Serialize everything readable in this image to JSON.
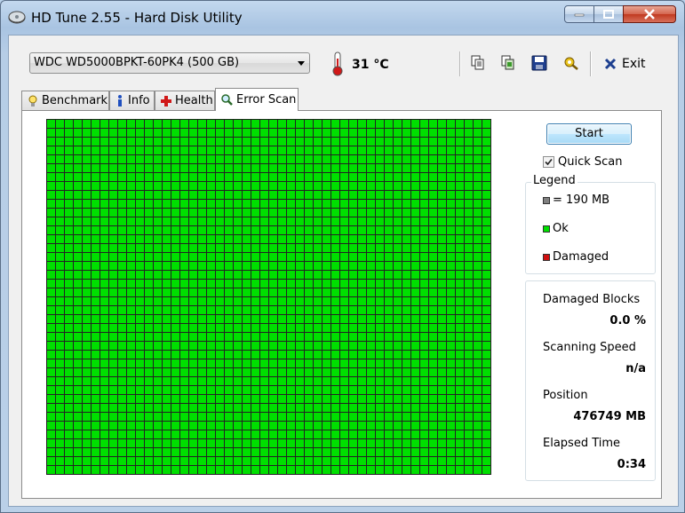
{
  "window": {
    "title": "HD Tune 2.55 - Hard Disk Utility",
    "app_icon": "hard-disk-icon"
  },
  "toolbar": {
    "drive": "WDC WD5000BPKT-60PK4 (500 GB)",
    "temperature": "31 °C",
    "icons": [
      "copy-info-icon",
      "copy-screenshot-icon",
      "save-icon",
      "options-icon"
    ],
    "exit_label": "Exit"
  },
  "tabs": [
    {
      "label": "Benchmark",
      "icon": "benchmark-icon"
    },
    {
      "label": "Info",
      "icon": "info-icon"
    },
    {
      "label": "Health",
      "icon": "health-icon"
    },
    {
      "label": "Error Scan",
      "icon": "magnifier-icon",
      "active": true
    }
  ],
  "error_scan": {
    "start_label": "Start",
    "quick_scan_label": "Quick Scan",
    "quick_scan_checked": true,
    "grid": {
      "rows": 40,
      "cols": 50,
      "status": "Ok"
    },
    "legend": {
      "title": "Legend",
      "items": [
        {
          "label": "= 190 MB",
          "color": "#808080"
        },
        {
          "label": "Ok",
          "color": "#00df00"
        },
        {
          "label": "Damaged",
          "color": "#d01010"
        }
      ]
    },
    "stats": {
      "damaged_blocks_label": "Damaged Blocks",
      "damaged_blocks_value": "0.0 %",
      "scanning_speed_label": "Scanning Speed",
      "scanning_speed_value": "n/a",
      "position_label": "Position",
      "position_value": "476749 MB",
      "elapsed_label": "Elapsed Time",
      "elapsed_value": "0:34"
    }
  }
}
